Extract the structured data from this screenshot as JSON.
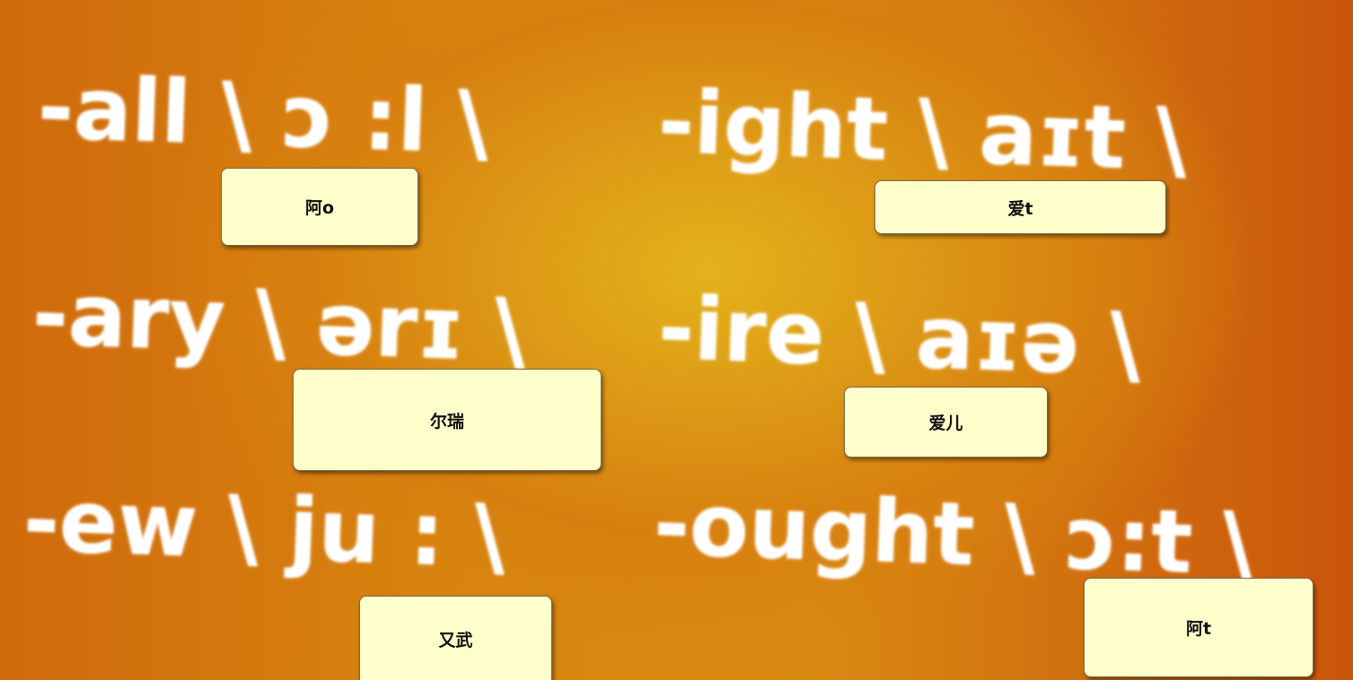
{
  "phonetics": [
    {
      "text": "-all \\ ɔ :l \\"
    },
    {
      "text": "-ight \\ aɪt \\"
    },
    {
      "text": "-ary \\ ərɪ \\"
    },
    {
      "text": "-ire \\ aɪə \\"
    },
    {
      "text": "-ew \\ ju : \\"
    },
    {
      "text": "-ought \\ ɔ:t \\"
    }
  ],
  "notes": [
    {
      "text": "阿o"
    },
    {
      "text": "爱t"
    },
    {
      "text": "尔瑞"
    },
    {
      "text": "爱儿"
    },
    {
      "text": "又武"
    },
    {
      "text": "阿t"
    }
  ],
  "colors": {
    "background_center": "#e3b21a",
    "background_edge": "#c9550b",
    "note_fill": "#ffffcc",
    "phonetic_text": "#ffffff"
  }
}
